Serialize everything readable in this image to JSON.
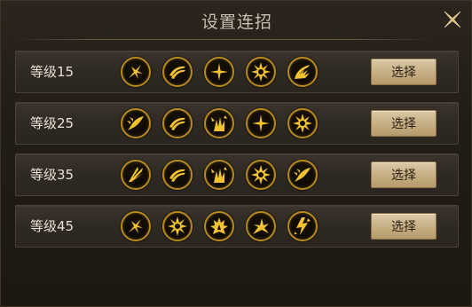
{
  "dialog": {
    "title": "设置连招"
  },
  "colors": {
    "gold": "#f2c230",
    "ring": "#b8891d"
  },
  "rows": [
    {
      "level": "等级15",
      "button": "选择",
      "skills": [
        "blade-burst-icon",
        "claw-swipe-icon",
        "cross-slash-icon",
        "spiked-sun-icon",
        "wave-strike-icon"
      ]
    },
    {
      "level": "等级25",
      "button": "选择",
      "skills": [
        "feather-dash-icon",
        "claw-swipe-icon",
        "crystal-spike-icon",
        "cross-slash-icon",
        "spiked-sun-icon"
      ]
    },
    {
      "level": "等级35",
      "button": "选择",
      "skills": [
        "fan-blades-icon",
        "claw-swipe-icon",
        "crystal-spike-icon",
        "spiked-sun-icon",
        "feather-dash-icon"
      ]
    },
    {
      "level": "等级45",
      "button": "选择",
      "skills": [
        "blade-burst-icon",
        "spiked-sun-icon",
        "flame-eruption-icon",
        "shatter-strike-icon",
        "lightning-burst-icon"
      ]
    }
  ]
}
